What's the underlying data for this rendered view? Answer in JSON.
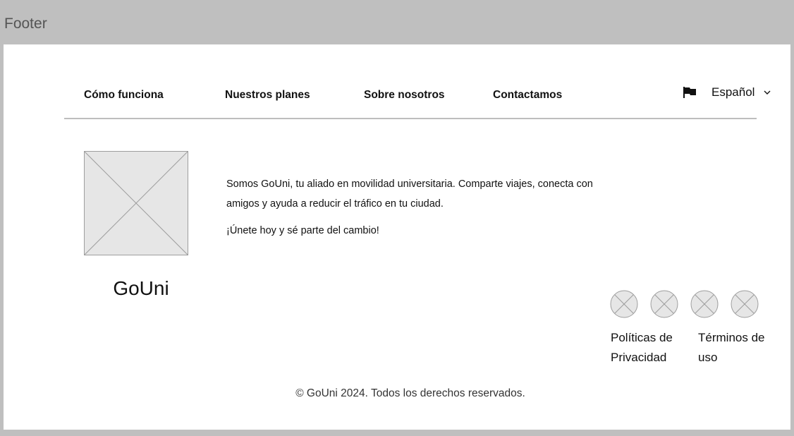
{
  "frame": {
    "label": "Footer"
  },
  "nav": {
    "items": [
      {
        "label": "Cómo funciona"
      },
      {
        "label": "Nuestros planes"
      },
      {
        "label": "Sobre nosotros"
      },
      {
        "label": "Contactamos"
      }
    ]
  },
  "language": {
    "selected": "Español",
    "icon": "flag-icon"
  },
  "brand": {
    "name": "GoUni",
    "description": "Somos GoUni, tu aliado en movilidad universitaria. Comparte viajes, conecta con amigos y ayuda a reducir el tráfico en tu ciudad.",
    "cta": "¡Únete hoy y sé parte del cambio!"
  },
  "social": {
    "icons": [
      "social-icon-1",
      "social-icon-2",
      "social-icon-3",
      "social-icon-4"
    ]
  },
  "legal": {
    "privacy": "Políticas de Privacidad",
    "terms": "Términos de uso"
  },
  "copyright": "© GoUni 2024. Todos los derechos reservados.",
  "colors": {
    "frame_bg": "#bfbfbf",
    "panel_bg": "#ffffff",
    "placeholder_fill": "#e6e6e6"
  }
}
